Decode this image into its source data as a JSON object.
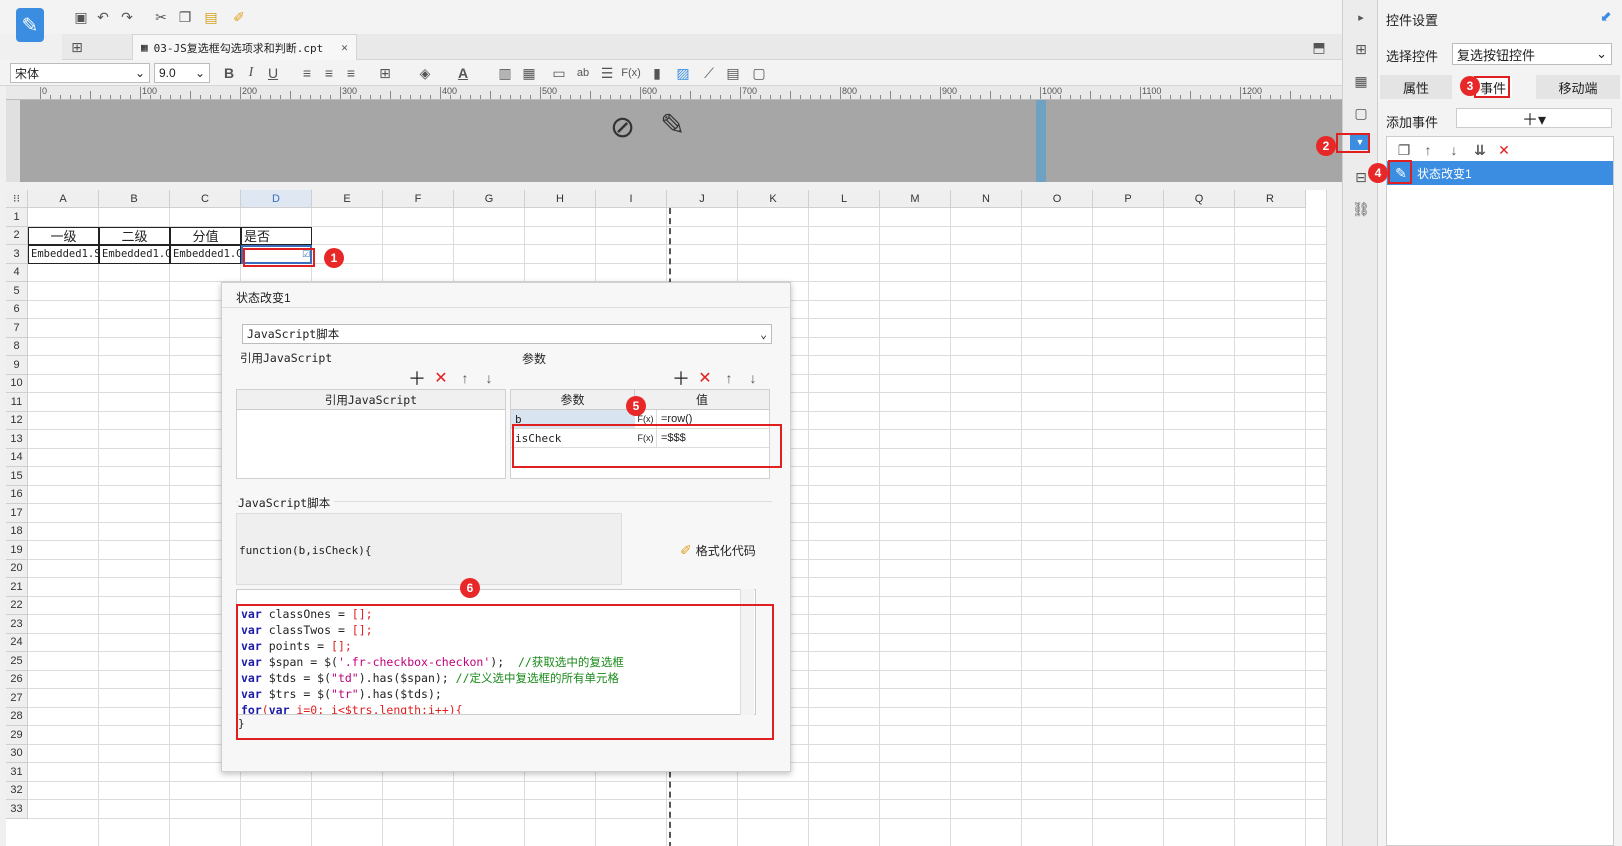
{
  "doc_tab": {
    "title": "03-JS复选框勾选项求和判断.cpt"
  },
  "format_bar": {
    "font": "宋体",
    "size": "9.0"
  },
  "ruler": {
    "marks": [
      "0",
      "100",
      "200",
      "300",
      "400",
      "500",
      "600",
      "700",
      "800",
      "900",
      "1000",
      "1100",
      "1200"
    ]
  },
  "grid": {
    "columns": [
      "A",
      "B",
      "C",
      "D",
      "E",
      "F",
      "G",
      "H",
      "I",
      "J",
      "K",
      "L",
      "M",
      "N",
      "O",
      "P",
      "Q",
      "R"
    ],
    "rows": [
      "1",
      "2",
      "3",
      "4",
      "5",
      "6",
      "7",
      "8",
      "9",
      "10",
      "11",
      "12",
      "13",
      "14",
      "15",
      "16",
      "17",
      "18",
      "19",
      "20",
      "21",
      "22",
      "23",
      "24",
      "25",
      "26",
      "27",
      "28",
      "29",
      "30",
      "31",
      "32",
      "33"
    ],
    "headers": [
      "一级",
      "二级",
      "分值",
      "是否"
    ],
    "row3": [
      "Embedded1.S",
      "Embedded1.G",
      "Embedded1.G",
      ""
    ]
  },
  "right_panel": {
    "title": "控件设置",
    "select_label": "选择控件",
    "select_value": "复选按钮控件",
    "tabs": [
      "属性",
      "事件",
      "移动端"
    ],
    "add_event_label": "添加事件",
    "event_item": "状态改变1"
  },
  "dialog": {
    "title": "状态改变1",
    "script_type": "JavaScript脚本",
    "ref_js_label": "引用JavaScript",
    "params_label": "参数",
    "ref_js_col": "引用JavaScript",
    "param_col": "参数",
    "value_col": "值",
    "params": [
      {
        "name": "b",
        "value": "=row()"
      },
      {
        "name": "isCheck",
        "value": "=$$$"
      }
    ],
    "script_label": "JavaScript脚本",
    "func_sig": "function(b,isCheck){",
    "format_label": "格式化代码",
    "closing": "}",
    "code": [
      [
        {
          "t": "var ",
          "c": "kw"
        },
        {
          "t": "classOnes = ",
          "c": ""
        },
        {
          "t": "[];",
          "c": "red"
        }
      ],
      [
        {
          "t": "var ",
          "c": "kw"
        },
        {
          "t": "classTwos = ",
          "c": ""
        },
        {
          "t": "[];",
          "c": "red"
        }
      ],
      [
        {
          "t": "var ",
          "c": "kw"
        },
        {
          "t": "points = ",
          "c": ""
        },
        {
          "t": "[];",
          "c": "red"
        }
      ],
      [
        {
          "t": "var ",
          "c": "kw"
        },
        {
          "t": "$span = $(",
          "c": ""
        },
        {
          "t": "'.fr-checkbox-checkon'",
          "c": "str"
        },
        {
          "t": ");  ",
          "c": ""
        },
        {
          "t": "//获取选中的复选框",
          "c": "cm"
        }
      ],
      [
        {
          "t": "var ",
          "c": "kw"
        },
        {
          "t": "$tds = $(",
          "c": ""
        },
        {
          "t": "\"td\"",
          "c": "str"
        },
        {
          "t": ").has($span); ",
          "c": ""
        },
        {
          "t": "//定义选中复选框的所有单元格",
          "c": "cm"
        }
      ],
      [
        {
          "t": "var ",
          "c": "kw"
        },
        {
          "t": "$trs = $(",
          "c": ""
        },
        {
          "t": "\"tr\"",
          "c": "str"
        },
        {
          "t": ").has($tds);",
          "c": ""
        }
      ],
      [
        {
          "t": "for",
          "c": "kw"
        },
        {
          "t": "(",
          "c": "red"
        },
        {
          "t": "var ",
          "c": "kw"
        },
        {
          "t": "i=0; i<$trs.length;i++){",
          "c": "red"
        }
      ]
    ]
  },
  "badges": [
    "1",
    "2",
    "3",
    "4",
    "5",
    "6"
  ]
}
